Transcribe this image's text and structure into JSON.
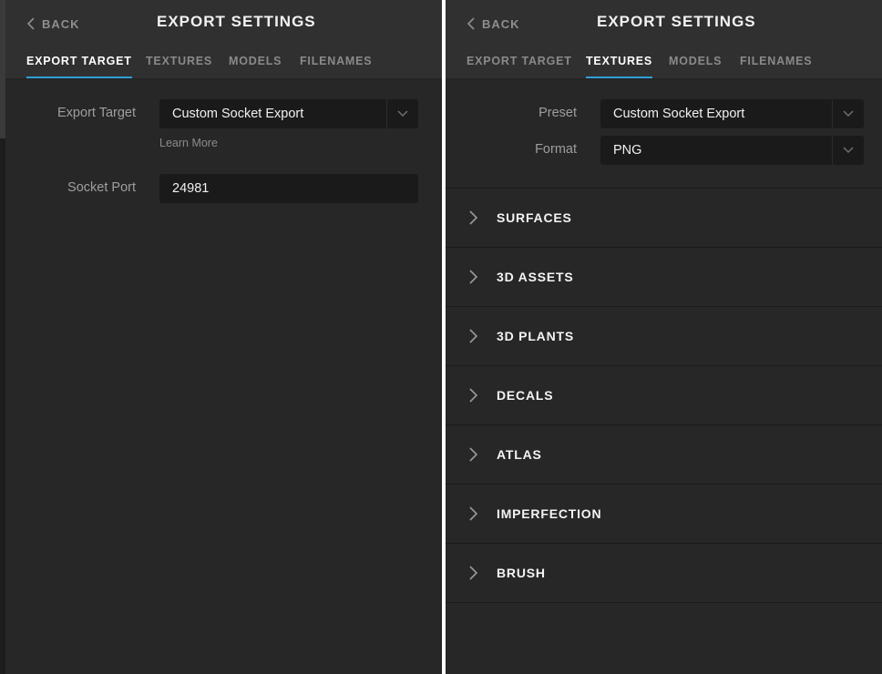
{
  "left_panel": {
    "back_label": "BACK",
    "title": "EXPORT SETTINGS",
    "tabs": [
      {
        "label": "EXPORT TARGET",
        "active": true
      },
      {
        "label": "TEXTURES",
        "active": false
      },
      {
        "label": "MODELS",
        "active": false
      },
      {
        "label": "FILENAMES",
        "active": false
      }
    ],
    "export_target": {
      "label": "Export Target",
      "value": "Custom Socket Export"
    },
    "learn_more": "Learn More",
    "socket_port": {
      "label": "Socket Port",
      "value": "24981"
    }
  },
  "right_panel": {
    "back_label": "BACK",
    "title": "EXPORT SETTINGS",
    "tabs": [
      {
        "label": "EXPORT TARGET",
        "active": false
      },
      {
        "label": "TEXTURES",
        "active": true
      },
      {
        "label": "MODELS",
        "active": false
      },
      {
        "label": "FILENAMES",
        "active": false
      }
    ],
    "preset": {
      "label": "Preset",
      "value": "Custom Socket Export"
    },
    "format": {
      "label": "Format",
      "value": "PNG"
    },
    "sections": [
      "SURFACES",
      "3D ASSETS",
      "3D PLANTS",
      "DECALS",
      "ATLAS",
      "IMPERFECTION",
      "BRUSH"
    ]
  },
  "colors": {
    "panel_bg": "#272727",
    "header_bg": "#303030",
    "field_bg": "#1a1a1a",
    "accent": "#2f9fd8",
    "divider": "#ffffff"
  },
  "icons": {
    "back": "chevron-left-icon",
    "dropdown": "chevron-down-icon",
    "section": "chevron-right-icon"
  }
}
